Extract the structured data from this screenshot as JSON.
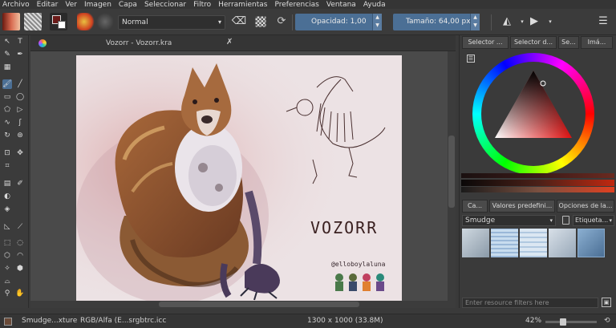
{
  "menu": [
    "Archivo",
    "Editar",
    "Ver",
    "Imagen",
    "Capa",
    "Seleccionar",
    "Filtro",
    "Herramientas",
    "Preferencias",
    "Ventana",
    "Ayuda"
  ],
  "toolbar": {
    "blend_mode": "Normal",
    "opacity_label": "Opacidad:  1,00",
    "size_label": "Tamaño:  64,00 px"
  },
  "document": {
    "title": "Vozorr - Vozorr.kra",
    "close_glyph": "✗"
  },
  "artwork": {
    "title": "VOZORR",
    "credit": "@elloboylaluna"
  },
  "right_panel": {
    "top_tabs": [
      "Selector ...",
      "Selector d...",
      "Se...",
      "Imá..."
    ],
    "lower_tabs": [
      "Ca...",
      "Valores predefini...",
      "Opciones de la..."
    ],
    "preset_name": "Smudge",
    "tag_label": "Etiqueta...",
    "filter_placeholder": "Enter resource filters here"
  },
  "status": {
    "brush": "Smudge...xture",
    "color_space": "RGB/Alfa (E...srgbtrc.icc",
    "dimensions": "1300 x 1000 (33.8M)",
    "zoom": "42%"
  }
}
